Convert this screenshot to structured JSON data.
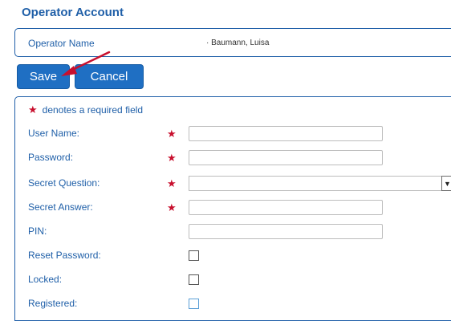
{
  "page": {
    "title": "Operator Account"
  },
  "operator": {
    "label": "Operator Name",
    "value": "· Baumann, Luisa"
  },
  "actions": {
    "save_label": "Save",
    "cancel_label": "Cancel"
  },
  "form": {
    "required_note": "denotes a required field",
    "required_marker": "★",
    "user_name_label": "User Name:",
    "password_label": "Password:",
    "secret_question_label": "Secret Question:",
    "secret_question_arrow": "▼",
    "secret_answer_label": "Secret Answer:",
    "pin_label": "PIN:",
    "reset_password_label": "Reset Password:",
    "locked_label": "Locked:",
    "registered_label": "Registered:"
  },
  "colors": {
    "accent": "#1f5fa8",
    "button": "#1f6fc3",
    "required": "#c8102e",
    "annotation_arrow": "#c8102e"
  }
}
